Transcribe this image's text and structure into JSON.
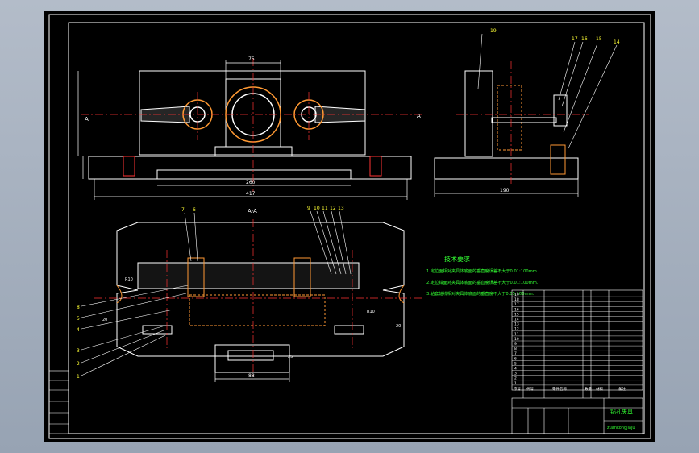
{
  "drawing": {
    "title_block": {
      "name": "钻孔夹具",
      "code": "zuankongjiaju"
    },
    "section_label": "A-A",
    "section_marks": [
      "A",
      "A"
    ],
    "technical_requirements": {
      "heading": "技术要求",
      "items": [
        "1.定位面相对夹具体底面的垂直度误差不大于0.01:100mm.",
        "2.定位钳面对夹具体底面的垂直度误差不大于0.01:100mm.",
        "3.钻套轴线相对夹具体底面的垂直度不大于0.05:100mm."
      ]
    },
    "dimensions": {
      "front_top": "75",
      "front_bottom_inner": "260",
      "front_bottom_outer": "417",
      "side_bottom": "190",
      "plan_bottom": "88",
      "plan_r_left": "R10",
      "plan_r_right": "R10",
      "plan_width_left": "20",
      "plan_width_right": "20",
      "plan_height": "25"
    },
    "balloons_side": [
      "19",
      "17",
      "16",
      "15",
      "14"
    ],
    "balloons_plan_top": [
      "7",
      "6",
      "9",
      "10",
      "11",
      "12",
      "13"
    ],
    "balloons_plan_left": [
      "8",
      "5",
      "4",
      "3",
      "2",
      "1"
    ],
    "parts_list": {
      "rows": [
        "19",
        "18",
        "17",
        "16",
        "15",
        "14",
        "13",
        "12",
        "11",
        "10",
        "9",
        "8",
        "7",
        "6",
        "5",
        "4",
        "3",
        "2",
        "1"
      ],
      "header": [
        "序号",
        "代号",
        "零件名称",
        "数量",
        "材料",
        "备注"
      ]
    }
  }
}
